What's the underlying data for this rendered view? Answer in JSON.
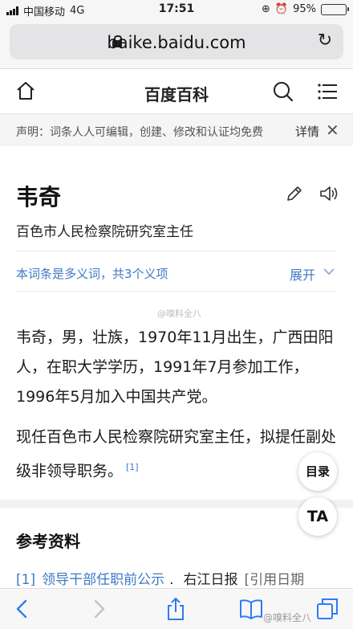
{
  "status_bar": {
    "carrier": "中国移动",
    "network": "4G",
    "time": "17:51",
    "battery": "95%",
    "battery_level": 0.95
  },
  "browser": {
    "url": "baike.baidu.com"
  },
  "site": {
    "title": "百度百科"
  },
  "notice": {
    "text": "声明：词条人人可编辑，创建、修改和认证均免费",
    "more": "详情"
  },
  "lemma": {
    "title": "韦奇",
    "description": "百色市人民检察院研究室主任",
    "polysemy": "本词条是多义词，共3个义项",
    "expand": "展开",
    "paragraph1": "韦奇，男，壮族，1970年11月出生，广西田阳人，在职大学学历，1991年7月参加工作，1996年5月加入中国共产党。",
    "paragraph2": "现任百色市人民检察院研究室主任，拟提任副处级非领导职务。",
    "paragraph2_ref": "[1]"
  },
  "floating": {
    "toc": "目录",
    "ta": "TA"
  },
  "references": {
    "title": "参考资料",
    "items": [
      {
        "num": "[1]",
        "link": "领导干部任职前公示",
        "sep": ".",
        "source": "右江日报",
        "cite": "[引用日期"
      }
    ]
  },
  "watermarks": {
    "top": "@嗅料全八",
    "bottom": "@嗅料全八"
  },
  "colors": {
    "link": "#3e7ac5",
    "battery": "#3ac25a"
  }
}
